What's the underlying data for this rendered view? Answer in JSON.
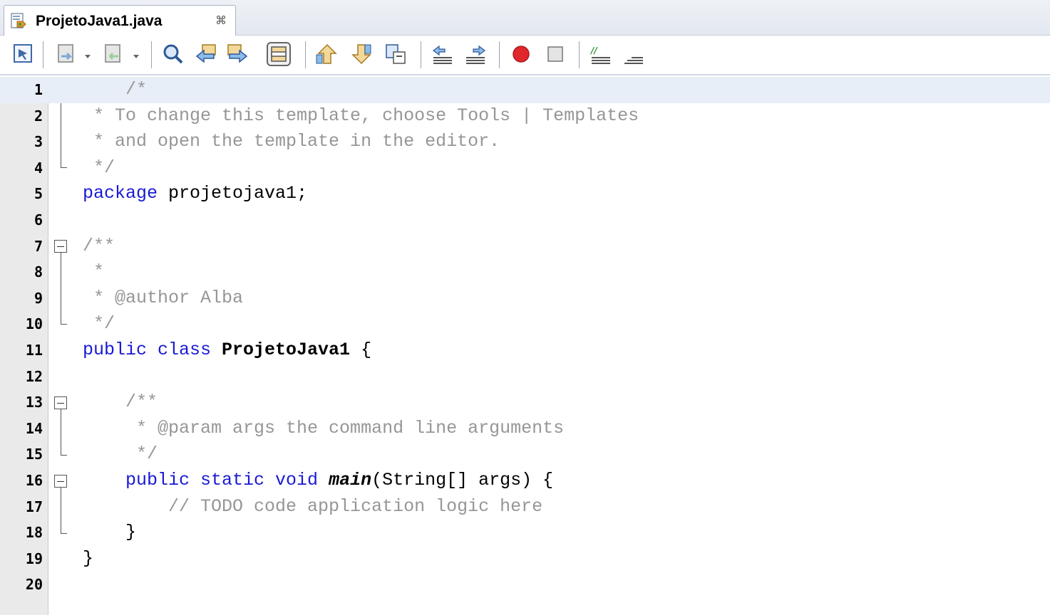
{
  "tab": {
    "title": "ProjetoJava1.java",
    "close_glyph": "⌘",
    "icon": "java-file-icon"
  },
  "toolbar": {
    "buttons": [
      "last-edit-icon",
      "back-icon",
      "forward-icon",
      "find-selection-icon",
      "find-previous-icon",
      "find-next-icon",
      "toggle-highlight-icon",
      "previous-bookmark-icon",
      "next-bookmark-icon",
      "toggle-bookmark-icon",
      "shift-left-icon",
      "shift-right-icon",
      "start-macro-icon",
      "stop-macro-icon",
      "comment-icon",
      "uncomment-icon"
    ]
  },
  "editor": {
    "line_numbers": [
      "1",
      "2",
      "3",
      "4",
      "5",
      "6",
      "7",
      "8",
      "9",
      "10",
      "11",
      "12",
      "13",
      "14",
      "15",
      "16",
      "17",
      "18",
      "19",
      "20"
    ],
    "lines": {
      "l1": "    /*",
      "l2": " * To change this template, choose Tools | Templates",
      "l3": " * and open the template in the editor.",
      "l4": " */",
      "l5_kw": "package",
      "l5_rest": " projetojava1;",
      "l7": "/**",
      "l8": " *",
      "l9": " * @author Alba",
      "l10": " */",
      "l11_kw": "public class",
      "l11_name": " ProjetoJava1",
      "l11_rest": " {",
      "l13": "    /**",
      "l14": "     * @param args the command line arguments",
      "l15": "     */",
      "l16_indent": "    ",
      "l16_kw": "public static void",
      "l16_space": " ",
      "l16_name": "main",
      "l16_rest": "(String[] args) {",
      "l17": "        // TODO code application logic here",
      "l18": "    }",
      "l19": "}"
    }
  },
  "colors": {
    "keyword": "#1a1ad4",
    "comment": "#969696",
    "current_line": "#e8eef7",
    "gutter": "#eaeaea"
  }
}
